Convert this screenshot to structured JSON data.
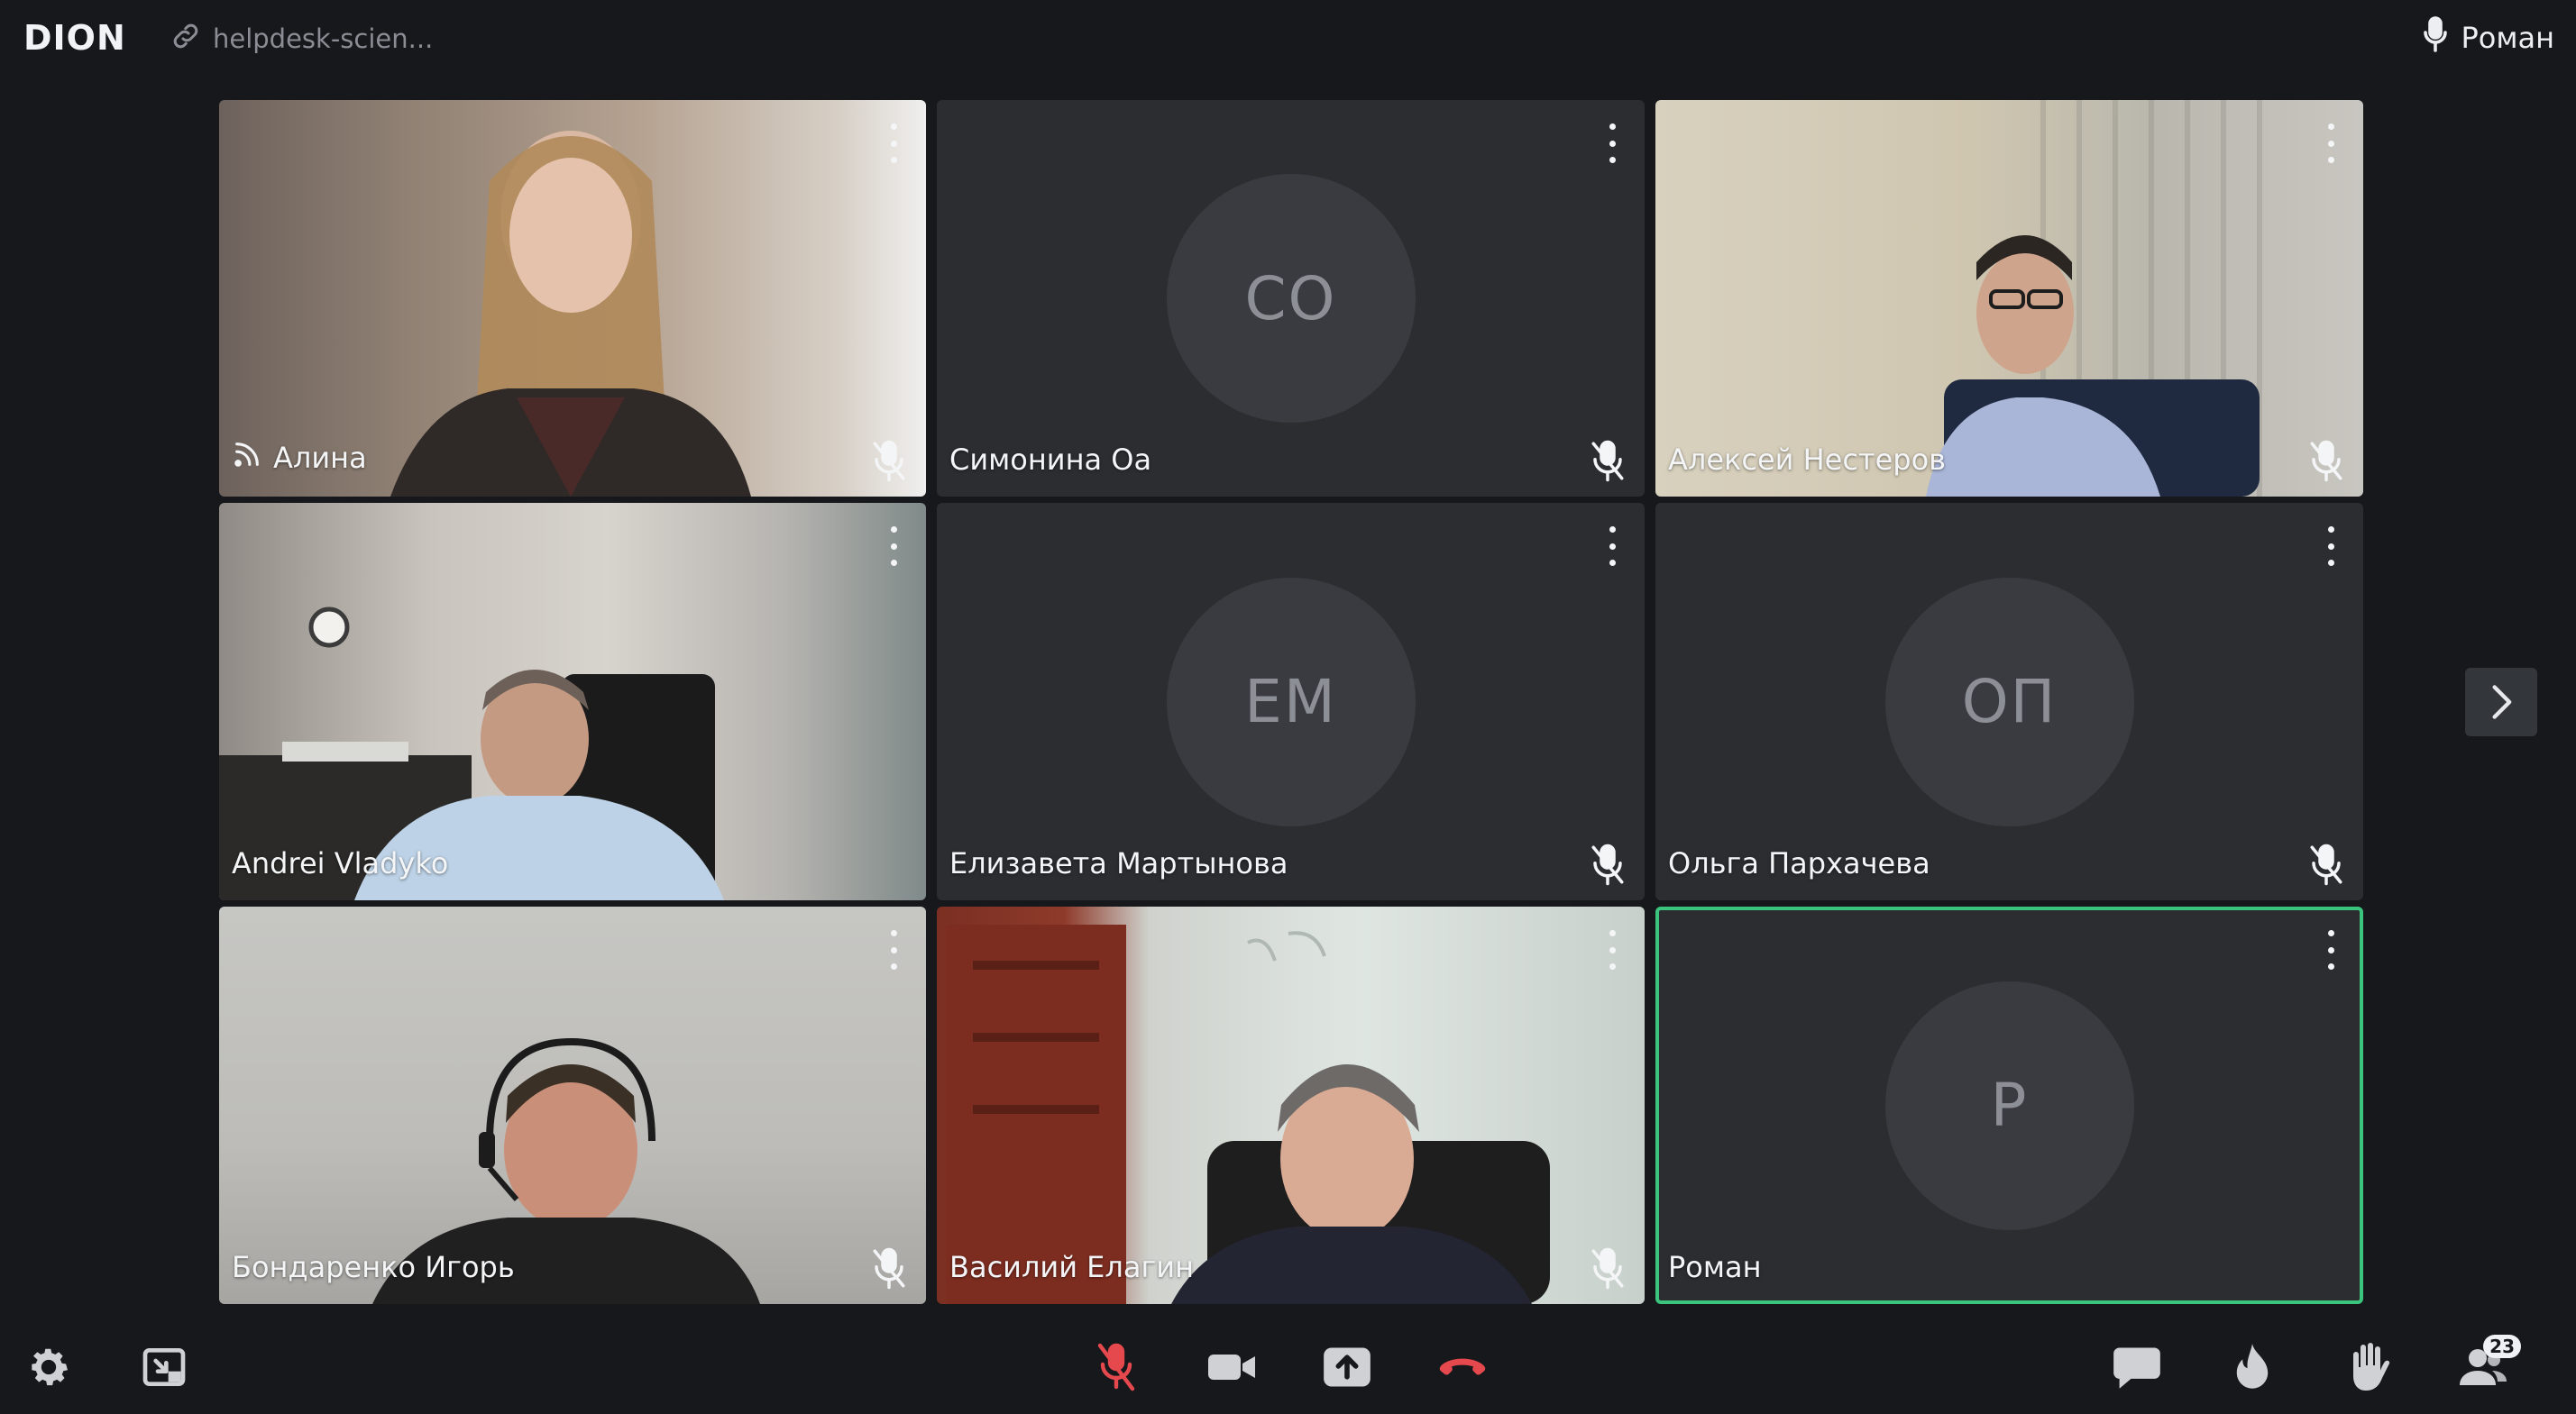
{
  "header": {
    "logo_text": "DION",
    "room_link": "helpdesk-scien...",
    "active_speaker": "Роман"
  },
  "participants": [
    {
      "name": "Алина",
      "initials": "",
      "camera": true,
      "mic_muted": true,
      "presenting": true
    },
    {
      "name": "Симонина Оа",
      "initials": "СО",
      "camera": false,
      "mic_muted": true
    },
    {
      "name": "Алексей Нестеров",
      "initials": "",
      "camera": true,
      "mic_muted": true
    },
    {
      "name": "Andrei Vladyko",
      "initials": "",
      "camera": true,
      "mic_muted": false
    },
    {
      "name": "Елизавета Мартынова",
      "initials": "ЕМ",
      "camera": false,
      "mic_muted": true
    },
    {
      "name": "Ольга Пархачева",
      "initials": "ОП",
      "camera": false,
      "mic_muted": true
    },
    {
      "name": "Бондаренко Игорь",
      "initials": "",
      "camera": true,
      "mic_muted": true
    },
    {
      "name": "Василий Елагин",
      "initials": "",
      "camera": true,
      "mic_muted": true
    },
    {
      "name": "Роман",
      "initials": "Р",
      "camera": false,
      "mic_muted": false,
      "active": true
    }
  ],
  "toolbar": {
    "participants_count": "23"
  },
  "colors": {
    "background": "#16181c",
    "tile": "#2b2d31",
    "avatar": "#393b40",
    "active_border": "#3ac47d",
    "danger": "#e5484d"
  },
  "icons": {
    "settings": "gear-icon",
    "picture_in_picture": "pip-icon",
    "microphone": "microphone-off-icon",
    "camera": "video-camera-icon",
    "share": "screen-share-icon",
    "hangup": "phone-hangup-icon",
    "chat": "chat-bubble-icon",
    "reactions": "flame-icon",
    "raise_hand": "hand-icon",
    "participants": "people-icon"
  }
}
